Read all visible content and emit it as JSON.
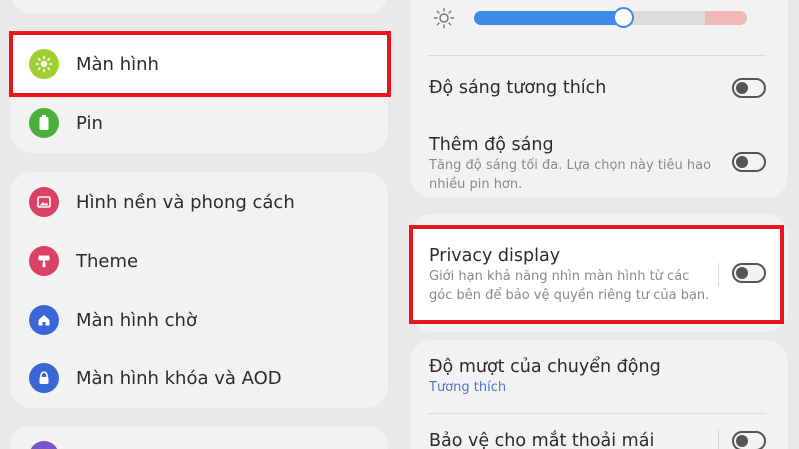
{
  "left_menu": {
    "group1": [
      {
        "label": "Màn hình",
        "icon": "sun-icon",
        "color": "#9ed12f",
        "highlighted": true
      },
      {
        "label": "Pin",
        "icon": "battery-icon",
        "color": "#4caf3c"
      }
    ],
    "group2": [
      {
        "label": "Hình nền và phong cách",
        "icon": "wallpaper-icon",
        "color": "#d94165"
      },
      {
        "label": "Theme",
        "icon": "paint-roller-icon",
        "color": "#d94165"
      },
      {
        "label": "Màn hình chờ",
        "icon": "home-icon",
        "color": "#3a66d8"
      },
      {
        "label": "Màn hình khóa và AOD",
        "icon": "lock-icon",
        "color": "#3a66d8"
      }
    ]
  },
  "brightness": {
    "icon": "sun-outline-icon",
    "level": 0.54
  },
  "settings": {
    "adaptive_brightness": {
      "title": "Độ sáng tương thích",
      "enabled": false
    },
    "extra_brightness": {
      "title": "Thêm độ sáng",
      "desc": "Tăng độ sáng tối đa. Lựa chọn này tiêu hao nhiều pin hơn.",
      "enabled": false
    },
    "privacy_display": {
      "title": "Privacy display",
      "desc": "Giới hạn khả năng nhìn màn hình từ các góc bên để bảo vệ quyền riêng tư của bạn.",
      "enabled": false
    },
    "motion_smoothness": {
      "title": "Độ mượt của chuyển động",
      "value": "Tương thích"
    },
    "eye_comfort": {
      "title": "Bảo vệ cho mắt thoải mái",
      "enabled": false
    }
  },
  "colors": {
    "highlight_border": "#e8151c",
    "slider_accent": "#3d8ae8",
    "link_blue": "#4a78c8"
  }
}
